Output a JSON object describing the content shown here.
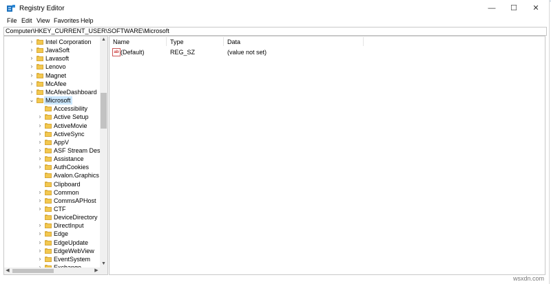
{
  "window": {
    "title": "Registry Editor",
    "minimize": "—",
    "maximize": "☐",
    "close": "✕"
  },
  "menu": [
    "File",
    "Edit",
    "View",
    "Favorites",
    "Help"
  ],
  "address": "Computer\\HKEY_CURRENT_USER\\SOFTWARE\\Microsoft",
  "tree": {
    "parents": [
      {
        "label": "Intel Corporation",
        "chevron": ">"
      },
      {
        "label": "JavaSoft",
        "chevron": ">"
      },
      {
        "label": "Lavasoft",
        "chevron": ">"
      },
      {
        "label": "Lenovo",
        "chevron": ">"
      },
      {
        "label": "Magnet",
        "chevron": ">"
      },
      {
        "label": "McAfee",
        "chevron": ">"
      },
      {
        "label": "McAfeeDashboard",
        "chevron": ">"
      },
      {
        "label": "Microsoft",
        "chevron": "v",
        "selected": true
      }
    ],
    "children": [
      {
        "label": "Accessibility",
        "chevron": ""
      },
      {
        "label": "Active Setup",
        "chevron": ">"
      },
      {
        "label": "ActiveMovie",
        "chevron": ">"
      },
      {
        "label": "ActiveSync",
        "chevron": ">"
      },
      {
        "label": "AppV",
        "chevron": ">"
      },
      {
        "label": "ASF Stream Descr",
        "chevron": ">"
      },
      {
        "label": "Assistance",
        "chevron": ">"
      },
      {
        "label": "AuthCookies",
        "chevron": ">"
      },
      {
        "label": "Avalon.Graphics",
        "chevron": ""
      },
      {
        "label": "Clipboard",
        "chevron": ""
      },
      {
        "label": "Common",
        "chevron": ">"
      },
      {
        "label": "CommsAPHost",
        "chevron": ">"
      },
      {
        "label": "CTF",
        "chevron": ">"
      },
      {
        "label": "DeviceDirectory",
        "chevron": ""
      },
      {
        "label": "DirectInput",
        "chevron": ">"
      },
      {
        "label": "Edge",
        "chevron": ">"
      },
      {
        "label": "EdgeUpdate",
        "chevron": ">"
      },
      {
        "label": "EdgeWebView",
        "chevron": ">"
      },
      {
        "label": "EventSystem",
        "chevron": ">"
      },
      {
        "label": "Exchange",
        "chevron": ">"
      }
    ]
  },
  "columns": {
    "name": "Name",
    "type": "Type",
    "data": "Data"
  },
  "values": [
    {
      "icon": "ab",
      "name": "(Default)",
      "type": "REG_SZ",
      "data": "(value not set)"
    }
  ],
  "scroll": {
    "up": "▲",
    "down": "▼",
    "left": "◀",
    "right": "▶"
  },
  "watermark": "wsxdn.com",
  "colors": {
    "selection": "#cce8ff",
    "folder": "#f3c84f"
  }
}
